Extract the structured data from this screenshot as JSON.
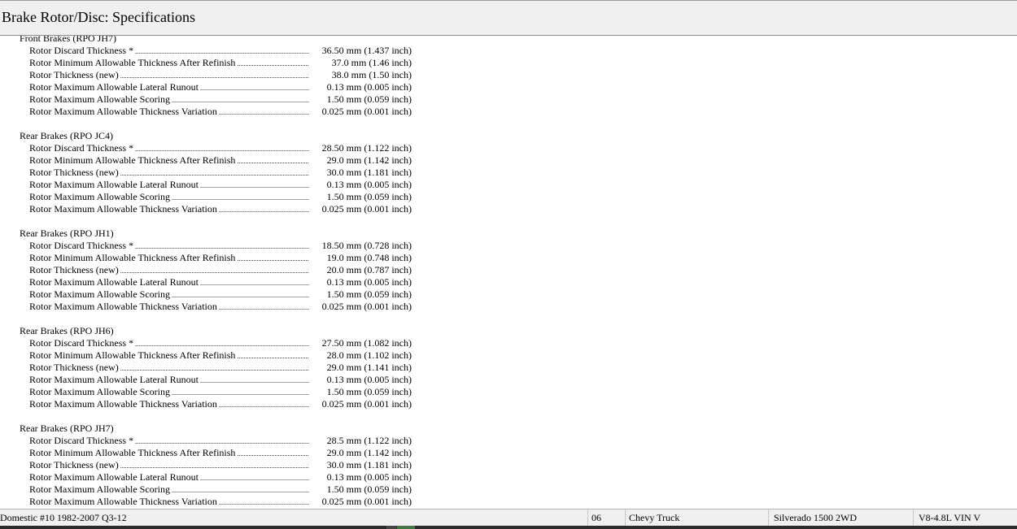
{
  "header": {
    "title": "Brake Rotor/Disc:  Specifications"
  },
  "sections": [
    {
      "title": "Front Brakes (RPO JH7)",
      "rows": [
        {
          "label": "Rotor Discard Thickness *",
          "value": "36.50 mm (1.437 inch)"
        },
        {
          "label": "Rotor Minimum Allowable Thickness After Refinish",
          "value": "37.0 mm (1.46 inch)"
        },
        {
          "label": "Rotor Thickness (new)",
          "value": "38.0 mm (1.50 inch)"
        },
        {
          "label": "Rotor Maximum Allowable Lateral Runout",
          "value": "0.13 mm (0.005 inch)"
        },
        {
          "label": "Rotor Maximum Allowable Scoring",
          "value": "1.50 mm (0.059 inch)"
        },
        {
          "label": "Rotor Maximum Allowable Thickness Variation",
          "value": "0.025 mm (0.001 inch)"
        }
      ]
    },
    {
      "title": "Rear Brakes (RPO JC4)",
      "rows": [
        {
          "label": "Rotor Discard Thickness *",
          "value": "28.50 mm (1.122 inch)"
        },
        {
          "label": "Rotor Minimum Allowable Thickness After Refinish",
          "value": "29.0 mm (1.142 inch)"
        },
        {
          "label": "Rotor Thickness (new)",
          "value": "30.0 mm (1.181 inch)"
        },
        {
          "label": "Rotor Maximum Allowable Lateral Runout",
          "value": "0.13 mm (0.005 inch)"
        },
        {
          "label": "Rotor Maximum Allowable Scoring",
          "value": "1.50 mm (0.059 inch)"
        },
        {
          "label": "Rotor Maximum Allowable Thickness Variation",
          "value": "0.025 mm (0.001 inch)"
        }
      ]
    },
    {
      "title": "Rear Brakes (RPO JH1)",
      "rows": [
        {
          "label": "Rotor Discard Thickness *",
          "value": "18.50 mm (0.728 inch)"
        },
        {
          "label": "Rotor Minimum Allowable Thickness After Refinish",
          "value": "19.0 mm (0.748 inch)"
        },
        {
          "label": "Rotor Thickness (new)",
          "value": "20.0 mm (0.787 inch)"
        },
        {
          "label": "Rotor Maximum Allowable Lateral Runout",
          "value": "0.13 mm (0.005 inch)"
        },
        {
          "label": "Rotor Maximum Allowable Scoring",
          "value": "1.50 mm (0.059 inch)"
        },
        {
          "label": "Rotor Maximum Allowable Thickness Variation",
          "value": "0.025 mm (0.001 inch)"
        }
      ]
    },
    {
      "title": "Rear Brakes (RPO JH6)",
      "rows": [
        {
          "label": "Rotor Discard Thickness *",
          "value": "27.50 mm (1.082 inch)"
        },
        {
          "label": "Rotor Minimum Allowable Thickness After Refinish",
          "value": "28.0 mm (1.102 inch)"
        },
        {
          "label": "Rotor Thickness (new)",
          "value": "29.0 mm (1.141 inch)"
        },
        {
          "label": "Rotor Maximum Allowable Lateral Runout",
          "value": "0.13 mm (0.005 inch)"
        },
        {
          "label": "Rotor Maximum Allowable Scoring",
          "value": "1.50 mm (0.059 inch)"
        },
        {
          "label": "Rotor Maximum Allowable Thickness Variation",
          "value": "0.025 mm (0.001 inch)"
        }
      ]
    },
    {
      "title": "Rear Brakes (RPO JH7)",
      "rows": [
        {
          "label": "Rotor Discard Thickness *",
          "value": "28.5 mm (1.122 inch)"
        },
        {
          "label": "Rotor Minimum Allowable Thickness After Refinish",
          "value": "29.0 mm (1.142 inch)"
        },
        {
          "label": "Rotor Thickness (new)",
          "value": "30.0 mm (1.181 inch)"
        },
        {
          "label": "Rotor Maximum Allowable Lateral Runout",
          "value": "0.13 mm (0.005 inch)"
        },
        {
          "label": "Rotor Maximum Allowable Scoring",
          "value": "1.50 mm (0.059 inch)"
        },
        {
          "label": "Rotor Maximum Allowable Thickness Variation",
          "value": "0.025 mm (0.001 inch)"
        }
      ]
    }
  ],
  "status_bar": {
    "database": "Domestic #10 1982-2007 Q3-12",
    "year": "06",
    "make": "Chevy Truck",
    "model": "Silverado 1500 2WD",
    "engine": "V8-4.8L VIN V"
  },
  "colors": {
    "header_bg": "#f0f0f0",
    "status_bg": "#f0f0f0",
    "taskbar": "#2b2b2b",
    "taskbar_accent": "#3d7a3d"
  }
}
